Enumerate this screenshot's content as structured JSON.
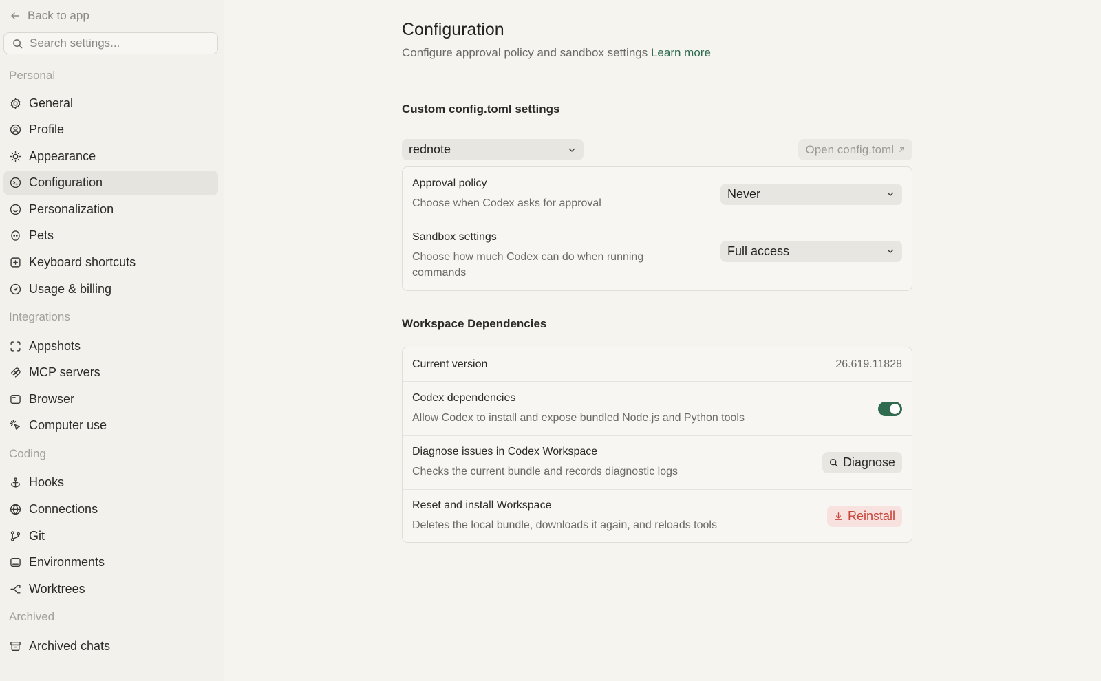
{
  "sidebar": {
    "back_label": "Back to app",
    "search_placeholder": "Search settings...",
    "sections": {
      "personal": "Personal",
      "integrations": "Integrations",
      "coding": "Coding",
      "archived": "Archived"
    },
    "items": {
      "general": "General",
      "profile": "Profile",
      "appearance": "Appearance",
      "configuration": "Configuration",
      "personalization": "Personalization",
      "pets": "Pets",
      "keyboard_shortcuts": "Keyboard shortcuts",
      "usage_billing": "Usage & billing",
      "appshots": "Appshots",
      "mcp_servers": "MCP servers",
      "browser": "Browser",
      "computer_use": "Computer use",
      "hooks": "Hooks",
      "connections": "Connections",
      "git": "Git",
      "environments": "Environments",
      "worktrees": "Worktrees",
      "archived_chats": "Archived chats"
    },
    "active_item": "configuration"
  },
  "main": {
    "title": "Configuration",
    "subtitle": "Configure approval policy and sandbox settings",
    "learn_more": "Learn more",
    "config_section": {
      "title": "Custom config.toml settings",
      "profile_select": "rednote",
      "open_config_label": "Open config.toml",
      "approval_policy": {
        "title": "Approval policy",
        "description": "Choose when Codex asks for approval",
        "value": "Never"
      },
      "sandbox_settings": {
        "title": "Sandbox settings",
        "description": "Choose how much Codex can do when running commands",
        "value": "Full access"
      }
    },
    "workspace_section": {
      "title": "Workspace Dependencies",
      "current_version": {
        "title": "Current version",
        "value": "26.619.11828"
      },
      "codex_dependencies": {
        "title": "Codex dependencies",
        "description": "Allow Codex to install and expose bundled Node.js and Python tools",
        "enabled": true
      },
      "diagnose": {
        "title": "Diagnose issues in Codex Workspace",
        "description": "Checks the current bundle and records diagnostic logs",
        "button": "Diagnose"
      },
      "reinstall": {
        "title": "Reset and install Workspace",
        "description": "Deletes the local bundle, downloads it again, and reloads tools",
        "button": "Reinstall"
      }
    }
  },
  "colors": {
    "accent_green": "#2f6b4f",
    "danger_red": "#c8453a",
    "background": "#f5f4ef"
  }
}
